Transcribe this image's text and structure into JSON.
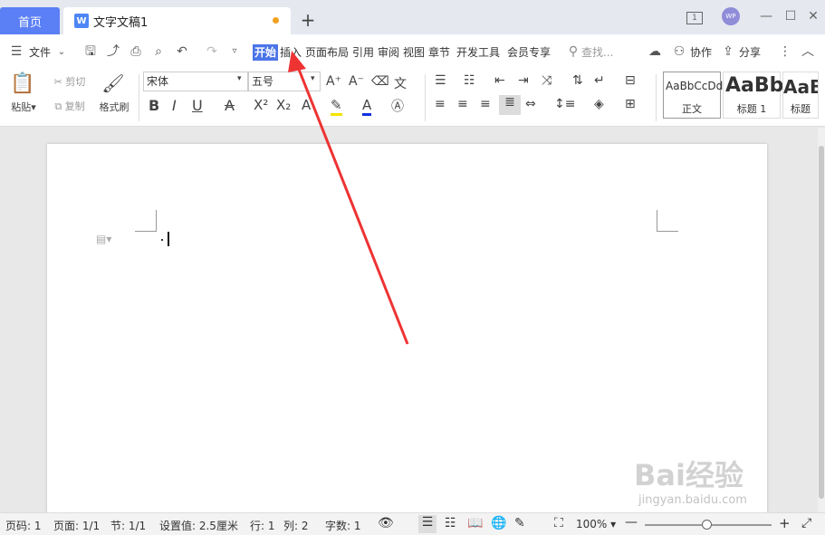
{
  "titlebar": {
    "home_tab": "首页",
    "doc_tab_title": "文字文稿1",
    "new_tab": "+",
    "page_count_icon": "1",
    "avatar": "WP"
  },
  "menubar": {
    "file": "文件",
    "tabs": [
      "开始",
      "插入",
      "页面布局",
      "引用",
      "审阅",
      "视图",
      "章节",
      "开发工具",
      "会员专享"
    ],
    "search_placeholder": "查找...",
    "collab": "协作",
    "share": "分享"
  },
  "ribbon": {
    "paste": "粘贴",
    "cut": "剪切",
    "copy": "复制",
    "format_painter": "格式刷",
    "font_name": "宋体",
    "font_size": "五号",
    "styles": [
      {
        "sample": "AaBbCcDd",
        "label": "正文"
      },
      {
        "sample": "AaBb",
        "label": "标题 1"
      },
      {
        "sample": "AaB",
        "label": "标题"
      }
    ]
  },
  "status": {
    "page": "页码: 1",
    "pages": "页面: 1/1",
    "section": "节: 1/1",
    "setting": "设置值: 2.5厘米",
    "row": "行: 1",
    "col": "列: 2",
    "words": "字数: 1",
    "zoom": "100%"
  },
  "watermark": {
    "brand": "Bai经验",
    "url": "jingyan.baidu.com"
  },
  "colors": {
    "accent": "#4b74e8",
    "arrow": "#ee3333",
    "home_tab": "#5b7ff5"
  }
}
